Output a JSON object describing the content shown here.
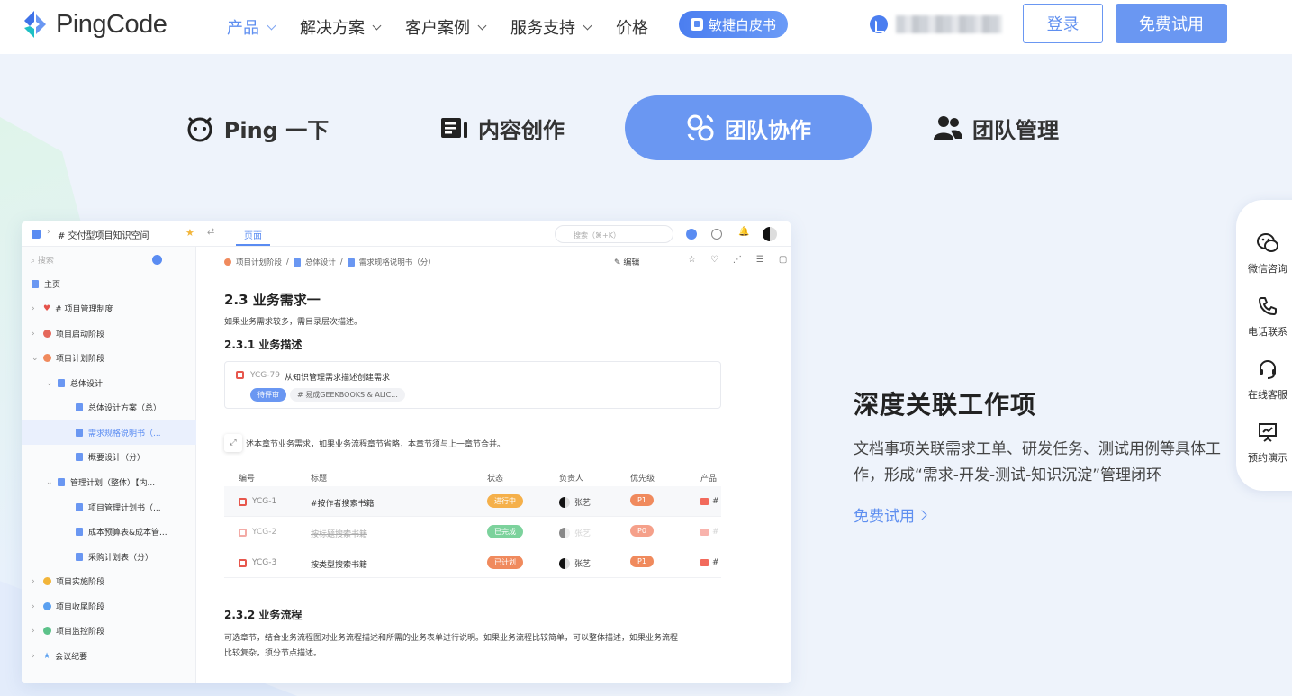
{
  "header": {
    "logo_text": "PingCode",
    "nav": [
      {
        "label": "产品",
        "active": true,
        "dropdown": true
      },
      {
        "label": "解决方案",
        "dropdown": true
      },
      {
        "label": "客户案例",
        "dropdown": true
      },
      {
        "label": "服务支持",
        "dropdown": true
      },
      {
        "label": "价格",
        "dropdown": false
      }
    ],
    "whitepaper_label": "敏捷白皮书",
    "login_label": "登录",
    "trial_label": "免费试用"
  },
  "feature_tabs": [
    {
      "label": "Ping 一下",
      "icon": "ping-icon"
    },
    {
      "label": "内容创作",
      "icon": "content-icon"
    },
    {
      "label": "团队协作",
      "icon": "collab-icon",
      "active": true
    },
    {
      "label": "团队管理",
      "icon": "team-icon"
    }
  ],
  "feature": {
    "title": "深度关联工作项",
    "description": "文档事项关联需求工单、研发任务、测试用例等具体工作，形成“需求-开发-测试-知识沉淀”管理闭环",
    "link": "免费试用"
  },
  "float_bar": [
    {
      "label": "微信咨询",
      "icon": "wechat-icon"
    },
    {
      "label": "电话联系",
      "icon": "phone-icon"
    },
    {
      "label": "在线客服",
      "icon": "headset-icon"
    },
    {
      "label": "预约演示",
      "icon": "demo-icon"
    }
  ],
  "mock": {
    "breadcrumb_space": "# 交付型项目知识空间",
    "tab_page": "页面",
    "search_placeholder": "搜索（⌘+K）",
    "sidebar_search": "搜索",
    "sidebar": [
      {
        "label": "主页",
        "type": "doc"
      },
      {
        "label": "# 项目管理制度",
        "type": "dot",
        "color": "#e5534b",
        "heart": true
      },
      {
        "label": "项目启动阶段",
        "type": "dot",
        "color": "#e5685b"
      },
      {
        "label": "项目计划阶段",
        "type": "dot",
        "color": "#f08a5d",
        "open": true
      },
      {
        "label": "总体设计",
        "type": "doc",
        "indent": 1,
        "open": true
      },
      {
        "label": "总体设计方案（总）",
        "type": "doc",
        "indent": 2
      },
      {
        "label": "需求规格说明书（...",
        "type": "doc",
        "indent": 2,
        "selected": true
      },
      {
        "label": "概要设计（分）",
        "type": "doc",
        "indent": 2
      },
      {
        "label": "管理计划（整体）【内...",
        "type": "doc",
        "indent": 1,
        "open": true
      },
      {
        "label": "项目管理计划书（...",
        "type": "doc",
        "indent": 2
      },
      {
        "label": "成本预算表&成本管...",
        "type": "doc",
        "indent": 2
      },
      {
        "label": "采购计划表（分）",
        "type": "doc",
        "indent": 2
      },
      {
        "label": "项目实施阶段",
        "type": "dot",
        "color": "#f2b53a"
      },
      {
        "label": "项目收尾阶段",
        "type": "dot",
        "color": "#5aa0f0"
      },
      {
        "label": "项目监控阶段",
        "type": "dot",
        "color": "#5cc28a"
      },
      {
        "label": "会议纪要",
        "type": "star"
      }
    ],
    "doc_breadcrumb": [
      "项目计划阶段",
      "总体设计",
      "需求规格说明书（分）"
    ],
    "edit_label": "编辑",
    "h_main": "2.3  业务需求一",
    "p_main": "如果业务需求较多，需目录层次描述。",
    "h_sub1": "2.3.1    业务描述",
    "card_id": "YCG-79",
    "card_title": "从知识管理需求描述创建需求",
    "card_status": "待评审",
    "card_tag": "# 易成GEEKBOOKS & ALIC...",
    "intro_text": "述本章节业务需求，如果业务流程章节省略，本章节须与上一章节合并。",
    "table_headers": [
      "编号",
      "标题",
      "状态",
      "负责人",
      "优先级",
      "产品"
    ],
    "table_rows": [
      {
        "id": "YCG-1",
        "title": "#按作者搜索书籍",
        "status": "进行中",
        "status_color": "#f5b04a",
        "owner": "张艺",
        "priority": "P1",
        "product": "#"
      },
      {
        "id": "YCG-2",
        "title": "按标题搜索书籍",
        "status": "已完成",
        "status_color": "#7cd29c",
        "owner": "张艺",
        "priority": "P0",
        "product": "#"
      },
      {
        "id": "YCG-3",
        "title": "按类型搜索书籍",
        "status": "已计划",
        "status_color": "#f08a5d",
        "owner": "张艺",
        "priority": "P1",
        "product": "#"
      }
    ],
    "h_sub2": "2.3.2    业务流程",
    "p_flow_1": "可选章节，结合业务流程图对业务流程描述和所需的业务表单进行说明。如果业务流程比较简单，可以整体描述，如果业务流程",
    "p_flow_2": "比较复杂，须分节点描述。"
  }
}
